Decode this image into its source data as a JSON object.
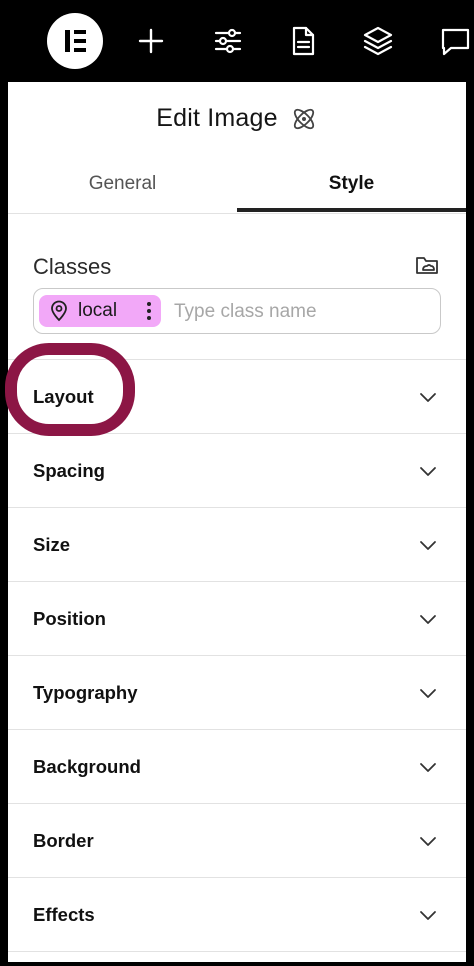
{
  "toolbar": {
    "logo": "elementor-logo",
    "icons": [
      "plus-icon",
      "sliders-icon",
      "page-icon",
      "layers-icon",
      "comment-icon"
    ]
  },
  "panel": {
    "title": "Edit Image",
    "title_icon": "atom-icon",
    "tabs": [
      {
        "label": "General",
        "active": false
      },
      {
        "label": "Style",
        "active": true
      }
    ]
  },
  "classes": {
    "label": "Classes",
    "chip_label": "local",
    "input_placeholder": "Type class name"
  },
  "sections": [
    {
      "label": "Layout"
    },
    {
      "label": "Spacing"
    },
    {
      "label": "Size"
    },
    {
      "label": "Position"
    },
    {
      "label": "Typography"
    },
    {
      "label": "Background"
    },
    {
      "label": "Border"
    },
    {
      "label": "Effects"
    }
  ],
  "colors": {
    "chip": "#f2a8f8",
    "highlight": "#8c1645",
    "toolbar": "#000000"
  }
}
